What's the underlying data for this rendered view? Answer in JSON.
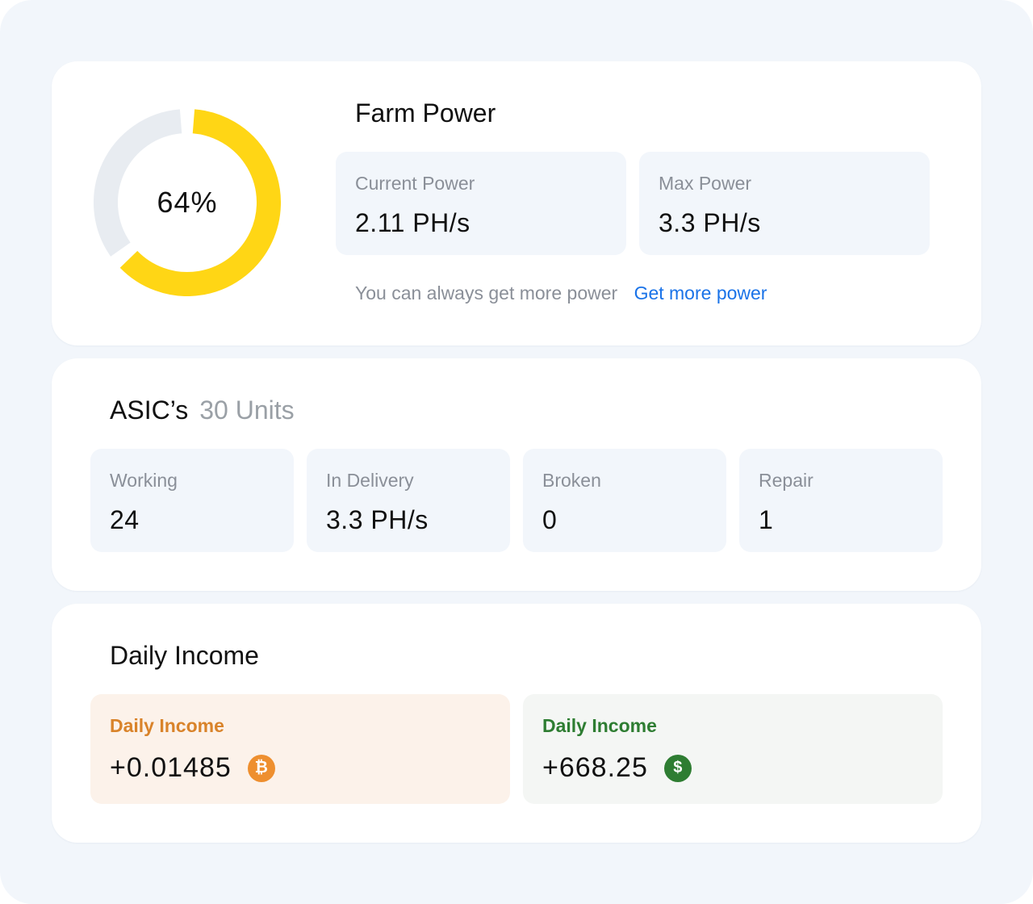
{
  "farm_power": {
    "title": "Farm Power",
    "percent_label": "64%",
    "percent_value": 64,
    "current_power": {
      "label": "Current Power",
      "value": "2.11 PH/s"
    },
    "max_power": {
      "label": "Max Power",
      "value": "3.3 PH/s"
    },
    "note": "You can always get more power",
    "link": "Get more power",
    "colors": {
      "fill": "#ffd615",
      "track": "#e8ecf1"
    }
  },
  "asics": {
    "title": "ASIC’s",
    "units": "30 Units",
    "stats": [
      {
        "label": "Working",
        "value": "24"
      },
      {
        "label": "In Delivery",
        "value": "3.3 PH/s"
      },
      {
        "label": "Broken",
        "value": "0"
      },
      {
        "label": "Repair",
        "value": "1"
      }
    ]
  },
  "daily_income": {
    "title": "Daily Income",
    "btc": {
      "label": "Daily Income",
      "value": "+0.01485",
      "icon": "bitcoin-icon",
      "glyph": "₿",
      "color": "#ee8f2f"
    },
    "usd": {
      "label": "Daily Income",
      "value": "+668.25",
      "icon": "dollar-icon",
      "glyph": "$",
      "color": "#2e7d32"
    }
  }
}
